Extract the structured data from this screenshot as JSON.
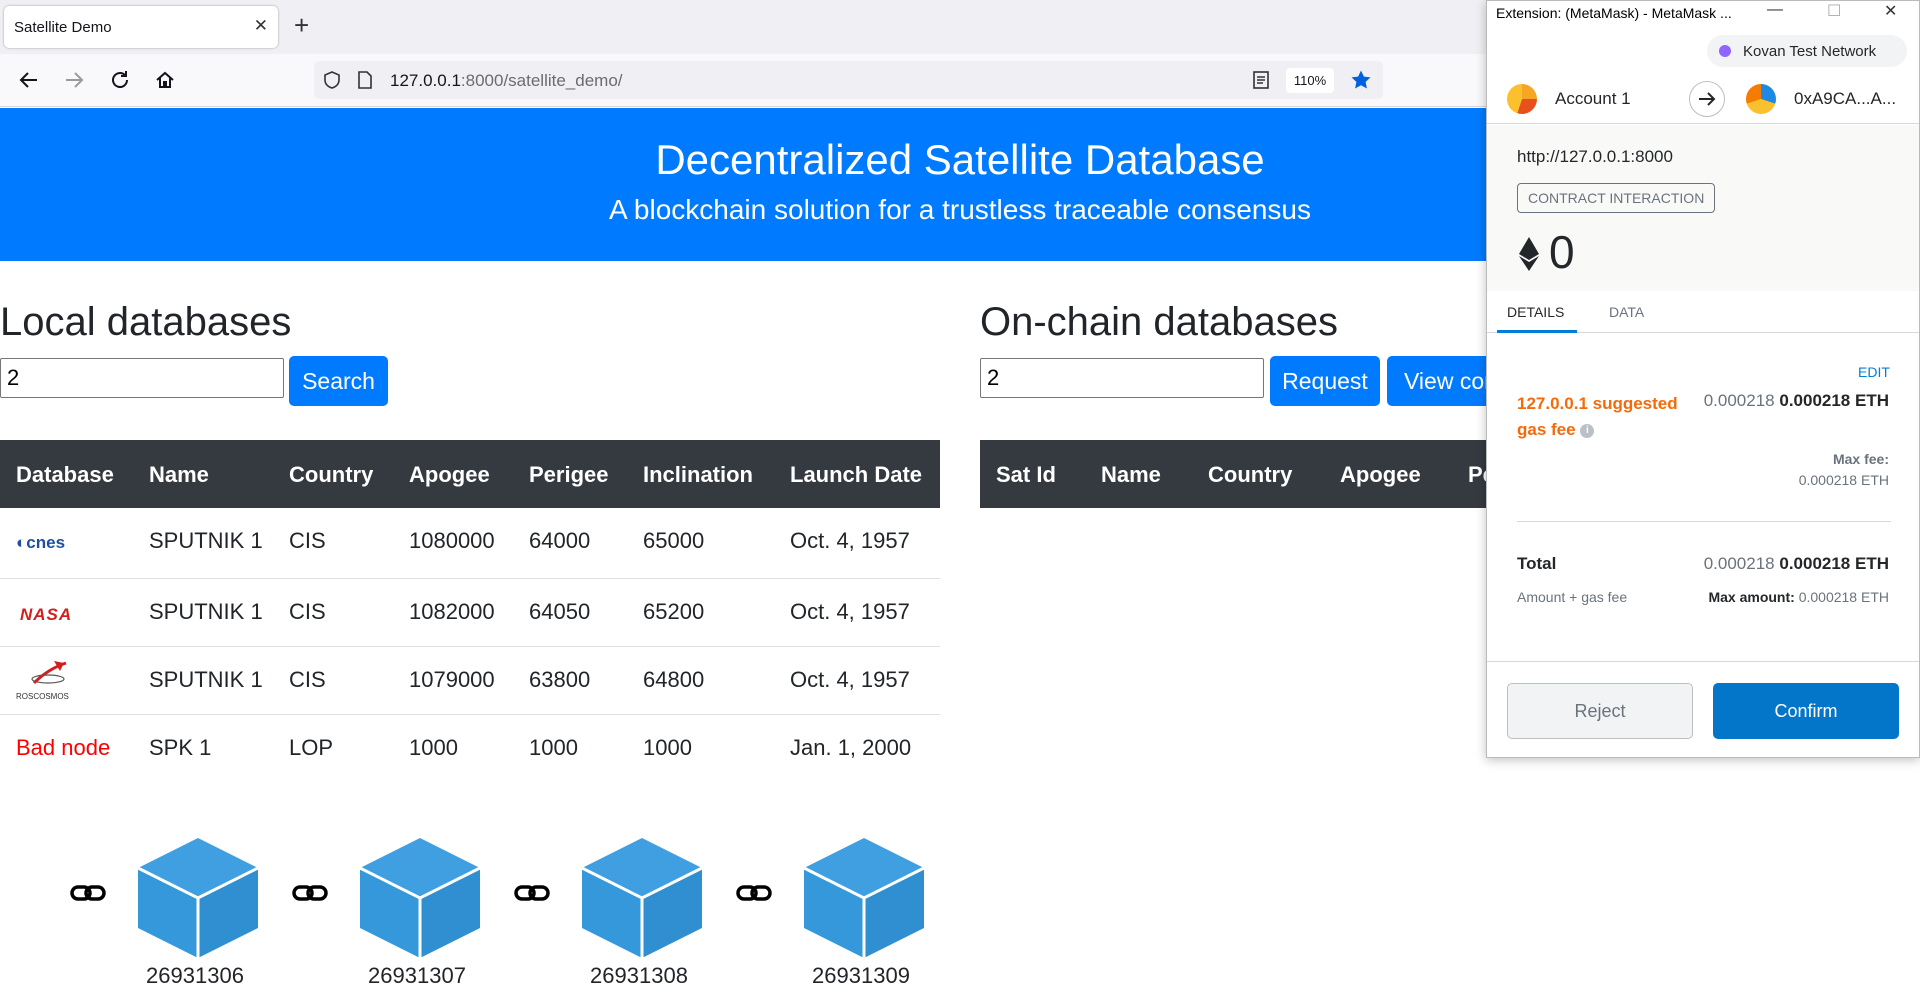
{
  "browser": {
    "tab_title": "Satellite Demo",
    "url_host": "127.0.0.1",
    "url_rest": ":8000/satellite_demo/",
    "zoom": "110%"
  },
  "hero": {
    "title": "Decentralized Satellite Database",
    "subtitle": "A blockchain solution for a trustless traceable consensus"
  },
  "local": {
    "title": "Local databases",
    "input_value": "2",
    "search_label": "Search",
    "headers": [
      "Database",
      "Name",
      "Country",
      "Apogee",
      "Perigee",
      "Inclination",
      "Launch Date"
    ],
    "rows": [
      {
        "database": "cnes",
        "name": "SPUTNIK 1",
        "country": "CIS",
        "apogee": "1080000",
        "perigee": "64000",
        "inclination": "65000",
        "launch": "Oct. 4, 1957"
      },
      {
        "database": "NASA",
        "name": "SPUTNIK 1",
        "country": "CIS",
        "apogee": "1082000",
        "perigee": "64050",
        "inclination": "65200",
        "launch": "Oct. 4, 1957"
      },
      {
        "database": "ROSCOSMOS",
        "name": "SPUTNIK 1",
        "country": "CIS",
        "apogee": "1079000",
        "perigee": "63800",
        "inclination": "64800",
        "launch": "Oct. 4, 1957"
      },
      {
        "database": "Bad node",
        "name": "SPK 1",
        "country": "LOP",
        "apogee": "1000",
        "perigee": "1000",
        "inclination": "1000",
        "launch": "Jan. 1, 2000"
      }
    ]
  },
  "onchain": {
    "title": "On-chain databases",
    "input_value": "2",
    "request_label": "Request",
    "view_label": "View cor",
    "headers": [
      "Sat Id",
      "Name",
      "Country",
      "Apogee",
      "Pe"
    ]
  },
  "blocks": [
    "26931306",
    "26931307",
    "26931308",
    "26931309"
  ],
  "colors": {
    "primary": "#007bff",
    "table_header": "#343a40",
    "block": "#3498db",
    "bad_node": "#ff0000",
    "metamask_confirm": "#0376c9",
    "gas_fee_label": "#f66a0a"
  },
  "metamask": {
    "window_title": "Extension: (MetaMask) - MetaMask ...",
    "network": "Kovan Test Network",
    "account_name": "Account 1",
    "to_address": "0xA9CA...A...",
    "origin": "http://127.0.0.1:8000",
    "tag": "CONTRACT INTERACTION",
    "amount": "0",
    "tab_details": "DETAILS",
    "tab_data": "DATA",
    "edit": "EDIT",
    "gas_label": "127.0.0.1 suggested gas fee",
    "gas_value_dim": "0.000218",
    "gas_value_bold": "0.000218 ETH",
    "max_fee_label": "Max fee:",
    "max_fee_value": "0.000218 ETH",
    "total_label": "Total",
    "total_value_dim": "0.000218",
    "total_value_bold": "0.000218 ETH",
    "total_sub": "Amount + gas fee",
    "max_amount_label": "Max amount:",
    "max_amount_value": "0.000218 ETH",
    "reject": "Reject",
    "confirm": "Confirm"
  }
}
